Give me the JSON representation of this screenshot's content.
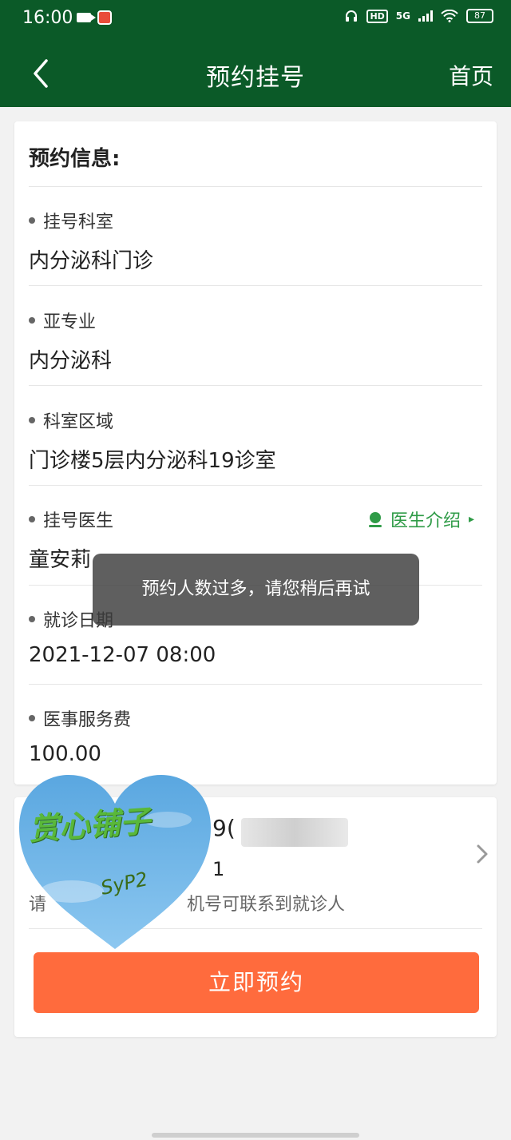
{
  "status_bar": {
    "time": "16:00",
    "hd": "HD",
    "network": "5G",
    "battery": "87"
  },
  "header": {
    "title": "预约挂号",
    "home_label": "首页"
  },
  "info_card": {
    "title": "预约信息:",
    "fields": [
      {
        "label": "挂号科室",
        "value": "内分泌科门诊"
      },
      {
        "label": "亚专业",
        "value": "内分泌科"
      },
      {
        "label": "科室区域",
        "value": "门诊楼5层内分泌科19诊室"
      },
      {
        "label": "挂号医生",
        "value": "童安莉"
      },
      {
        "label": "就诊日期",
        "value": "2021-12-07  08:00"
      },
      {
        "label": "医事服务费",
        "value": "100.00"
      }
    ],
    "doctor_intro_link": "医生介绍"
  },
  "patient_card": {
    "line1": "9(",
    "line2": "1",
    "hint": "请",
    "hint_tail": "机号可联系到就诊人",
    "submit_label": "立即预约"
  },
  "toast": {
    "message": "预约人数过多，请您稍后再试"
  },
  "sticker": {
    "text": "赏心铺子",
    "signature": "SyP2"
  },
  "colors": {
    "header_bg": "#0b5a28",
    "accent_green": "#2f9b47",
    "button_orange": "#ff6b3d"
  }
}
